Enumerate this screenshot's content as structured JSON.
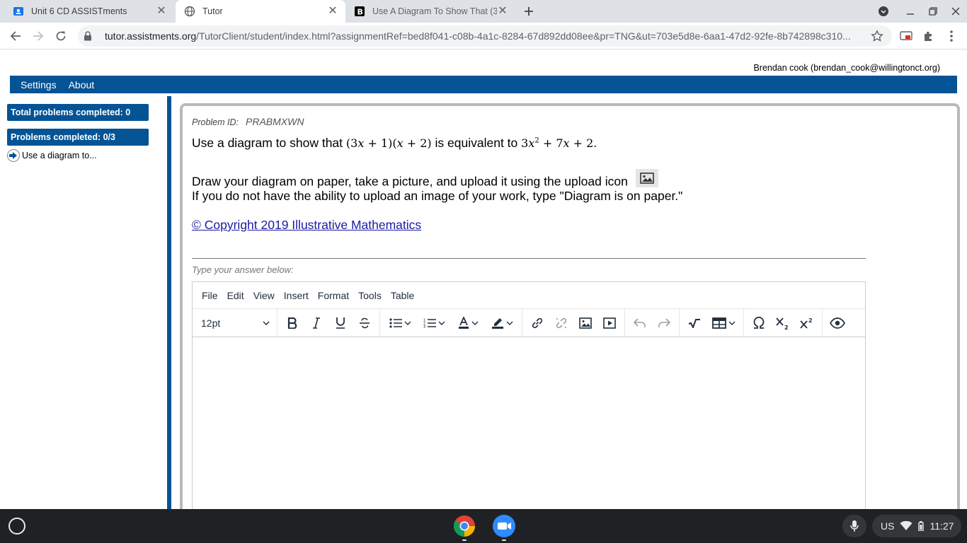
{
  "browser": {
    "tabs": [
      {
        "title": "Unit 6 CD ASSISTments",
        "active": false
      },
      {
        "title": "Tutor",
        "active": true
      },
      {
        "title": "Use A Diagram To Show That (3",
        "active": false
      }
    ],
    "url_host": "tutor.assistments.org",
    "url_path": "/TutorClient/student/index.html?assignmentRef=bed8f041-c08b-4a1c-8284-67d892dd08ee&pr=TNG&ut=703e5d8e-6aa1-47d2-92fe-8b742898c310..."
  },
  "header": {
    "user": "Brendan cook (brendan_cook@willingtonct.org)",
    "menu": {
      "settings": "Settings",
      "about": "About"
    }
  },
  "sidebar": {
    "total_completed": "Total problems completed: 0",
    "problems_completed": "Problems completed: 0/3",
    "current_problem": "Use a diagram to..."
  },
  "problem": {
    "id_label": "Problem ID:",
    "id_value": "PRABMXWN",
    "question_prefix": "Use a diagram to show that",
    "question_mid": "is equivalent to",
    "expr1": {
      "a": "(3",
      "b": "x",
      "c": " + 1)(",
      "d": "x",
      "e": " + 2)"
    },
    "expr2": {
      "a": "3",
      "b": "x",
      "sup": "2",
      "c": " + 7",
      "d": "x",
      "e": " + 2"
    },
    "question_end": ".",
    "instruction1": "Draw your diagram on paper, take a picture, and upload it using the upload icon",
    "instruction2": "If you do not have the ability to upload an image of your work, type \"Diagram is on paper.\"",
    "copyright": "© Copyright 2019 Illustrative Mathematics",
    "answer_prompt": "Type your answer below:"
  },
  "editor": {
    "menus": [
      "File",
      "Edit",
      "View",
      "Insert",
      "Format",
      "Tools",
      "Table"
    ],
    "font_size": "12pt"
  },
  "shelf": {
    "locale": "US",
    "time": "11:27"
  },
  "colors": {
    "brand": "#045395",
    "link": "#1a1aa6"
  }
}
